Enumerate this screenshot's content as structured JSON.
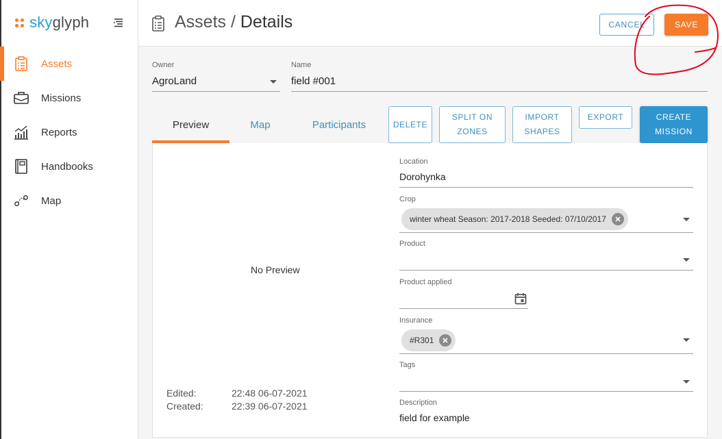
{
  "brand": {
    "logo_part1": "sky",
    "logo_part2": "glyph"
  },
  "sidebar": {
    "items": [
      {
        "label": "Assets",
        "icon": "clipboard-icon",
        "active": true
      },
      {
        "label": "Missions",
        "icon": "briefcase-icon"
      },
      {
        "label": "Reports",
        "icon": "chart-icon"
      },
      {
        "label": "Handbooks",
        "icon": "book-icon"
      },
      {
        "label": "Map",
        "icon": "route-icon"
      }
    ]
  },
  "header": {
    "crumb_parent": "Assets",
    "separator": " / ",
    "crumb_current": "Details",
    "cancel_label": "CANCEL",
    "save_label": "SAVE"
  },
  "form": {
    "owner": {
      "label": "Owner",
      "value": "AgroLand"
    },
    "name": {
      "label": "Name",
      "value": "field #001"
    }
  },
  "tabs": [
    {
      "label": "Preview",
      "active": true
    },
    {
      "label": "Map"
    },
    {
      "label": "Participants"
    }
  ],
  "actions": {
    "delete_label": "DELETE",
    "split_line1": "SPLIT ON",
    "split_line2": "ZONES",
    "import_line1": "IMPORT",
    "import_line2": "SHAPES",
    "export_label": "EXPORT",
    "create_line1": "CREATE",
    "create_line2": "MISSION"
  },
  "preview": {
    "placeholder": "No Preview",
    "edited_label": "Edited:",
    "edited_value": "22:48 06-07-2021",
    "created_label": "Created:",
    "created_value": "22:39 06-07-2021"
  },
  "details": {
    "location": {
      "label": "Location",
      "value": "Dorohynka"
    },
    "crop": {
      "label": "Crop",
      "chip": "winter wheat Season: 2017-2018 Seeded: 07/10/2017"
    },
    "product": {
      "label": "Product",
      "value": ""
    },
    "product_applied": {
      "label": "Product applied",
      "value": ""
    },
    "insurance": {
      "label": "Insurance",
      "chip": "#R301"
    },
    "tags": {
      "label": "Tags",
      "value": ""
    },
    "description": {
      "label": "Description",
      "value": "field for example"
    }
  },
  "colors": {
    "accent": "#f47c2c",
    "link": "#3d8fbf",
    "primary": "#2f95cf",
    "annotation": "#e8001c"
  }
}
